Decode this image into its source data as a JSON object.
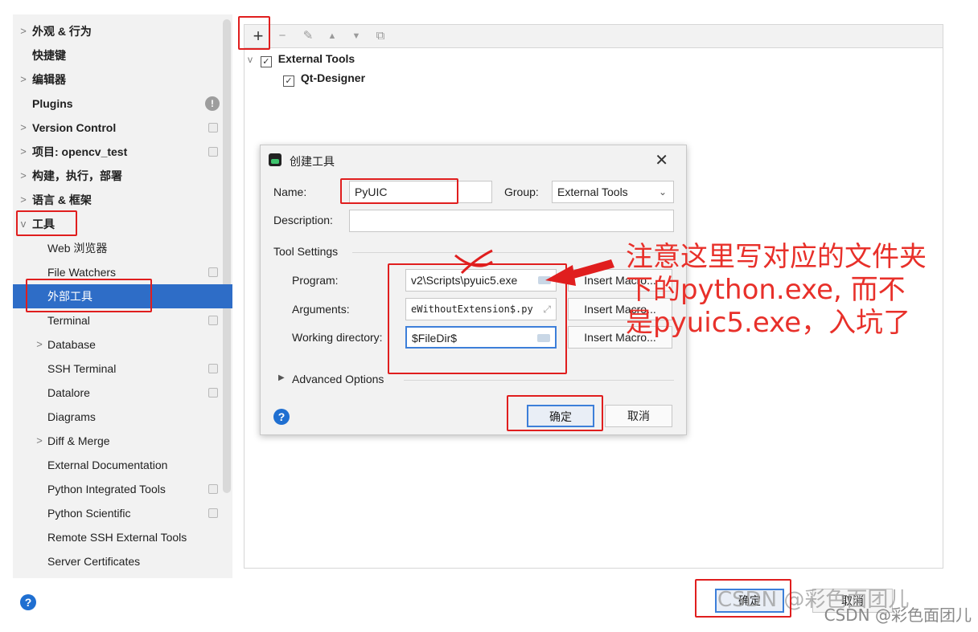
{
  "sidebar": {
    "items": [
      {
        "label": "外观 & 行为",
        "arrow": ">"
      },
      {
        "label": "快捷键"
      },
      {
        "label": "编辑器",
        "arrow": ">"
      },
      {
        "label": "Plugins"
      },
      {
        "label": "Version Control",
        "arrow": ">"
      },
      {
        "label": "项目: opencv_test",
        "arrow": ">"
      },
      {
        "label": "构建，执行，部署",
        "arrow": ">"
      },
      {
        "label": "语言 & 框架",
        "arrow": ">"
      },
      {
        "label": "工具",
        "arrow": "v"
      },
      {
        "label": "Web 浏览器"
      },
      {
        "label": "File Watchers"
      },
      {
        "label": "外部工具"
      },
      {
        "label": "Terminal"
      },
      {
        "label": "Database",
        "arrow": ">"
      },
      {
        "label": "SSH Terminal"
      },
      {
        "label": "Datalore"
      },
      {
        "label": "Diagrams"
      },
      {
        "label": "Diff & Merge",
        "arrow": ">"
      },
      {
        "label": "External Documentation"
      },
      {
        "label": "Python Integrated Tools"
      },
      {
        "label": "Python Scientific"
      },
      {
        "label": "Remote SSH External Tools"
      },
      {
        "label": "Server Certificates"
      }
    ],
    "plugins_badge": "!"
  },
  "toolbar": {
    "add": "+",
    "remove": "−",
    "edit": "✎",
    "up": "▲",
    "down": "▼",
    "copy": "⧉"
  },
  "tree": {
    "group_label": "External Tools",
    "group_arrow": "v",
    "tool_label": "Qt-Designer",
    "check": "✓"
  },
  "dialog": {
    "title": "创建工具",
    "close": "✕",
    "name_label": "Name:",
    "name_value": "PyUIC",
    "group_label": "Group:",
    "group_value": "External Tools",
    "description_label": "Description:",
    "description_value": "",
    "section_title": "Tool Settings",
    "program_label": "Program:",
    "program_value": "v2\\Scripts\\pyuic5.exe",
    "arguments_label": "Arguments:",
    "arguments_value": "eWithoutExtension$.py",
    "workdir_label": "Working directory:",
    "workdir_value": "$FileDir$",
    "insert_macro": "Insert Macro...",
    "advanced_arrow": "▶",
    "advanced_label": "Advanced Options",
    "ok": "确定",
    "cancel": "取消",
    "help": "?"
  },
  "footer": {
    "help": "?",
    "ok": "确定",
    "cancel": "取消"
  },
  "annotations": {
    "note": "注意这里写对应的文件夹下的python.exe, 而不是pyuic5.exe，入坑了",
    "cross_mark": "X",
    "watermark": "CSDN @彩色面团儿"
  },
  "colors": {
    "accent": "#2e6dc7",
    "annotation_red": "#e01e1e",
    "annotation_text": "#e8302a"
  }
}
